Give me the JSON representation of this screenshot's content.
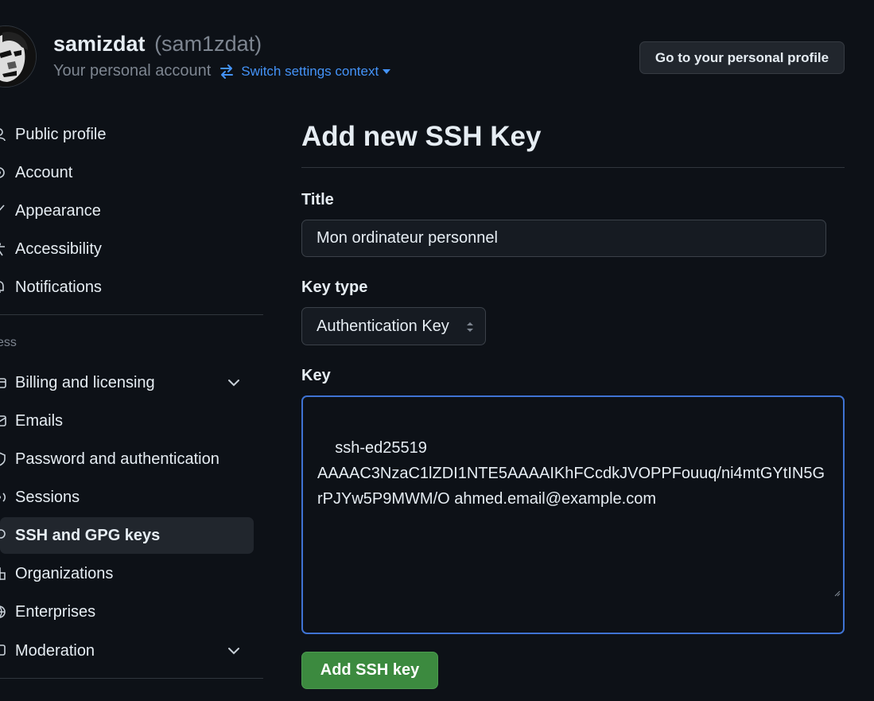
{
  "header": {
    "display_name": "samizdat",
    "login": "(sam1zdat)",
    "subtitle": "Your personal account",
    "switch_label": "Switch settings context",
    "profile_button": "Go to your personal profile"
  },
  "sidebar": {
    "items": [
      {
        "label": "Public profile",
        "icon": "person-icon"
      },
      {
        "label": "Account",
        "icon": "gear-icon"
      },
      {
        "label": "Appearance",
        "icon": "paintbrush-icon"
      },
      {
        "label": "Accessibility",
        "icon": "accessibility-icon"
      },
      {
        "label": "Notifications",
        "icon": "bell-icon"
      }
    ],
    "access_label": "ccess",
    "access_items": [
      {
        "label": "Billing and licensing",
        "icon": "credit-card-icon",
        "expandable": true
      },
      {
        "label": "Emails",
        "icon": "mail-icon"
      },
      {
        "label": "Password and authentication",
        "icon": "shield-lock-icon"
      },
      {
        "label": "Sessions",
        "icon": "broadcast-icon"
      },
      {
        "label": "SSH and GPG keys",
        "icon": "key-icon",
        "active": true
      },
      {
        "label": "Organizations",
        "icon": "organization-icon"
      },
      {
        "label": "Enterprises",
        "icon": "globe-icon"
      },
      {
        "label": "Moderation",
        "icon": "report-icon",
        "expandable": true
      }
    ]
  },
  "form": {
    "page_title": "Add new SSH Key",
    "title_label": "Title",
    "title_value": "Mon ordinateur personnel",
    "key_type_label": "Key type",
    "key_type_value": "Authentication Key",
    "key_label": "Key",
    "key_value": "ssh-ed25519\nAAAAC3NzaC1lZDI1NTE5AAAAIKhFCcdkJVOPPFouuq/ni4mtGYtIN5GrPJYw5P9MWM/O ahmed.email@example.com",
    "submit_label": "Add SSH key"
  },
  "colors": {
    "background": "#0d1117",
    "accent_link": "#4493f8",
    "primary_button": "#3c8a3f",
    "focus_border": "#3f73d3"
  }
}
